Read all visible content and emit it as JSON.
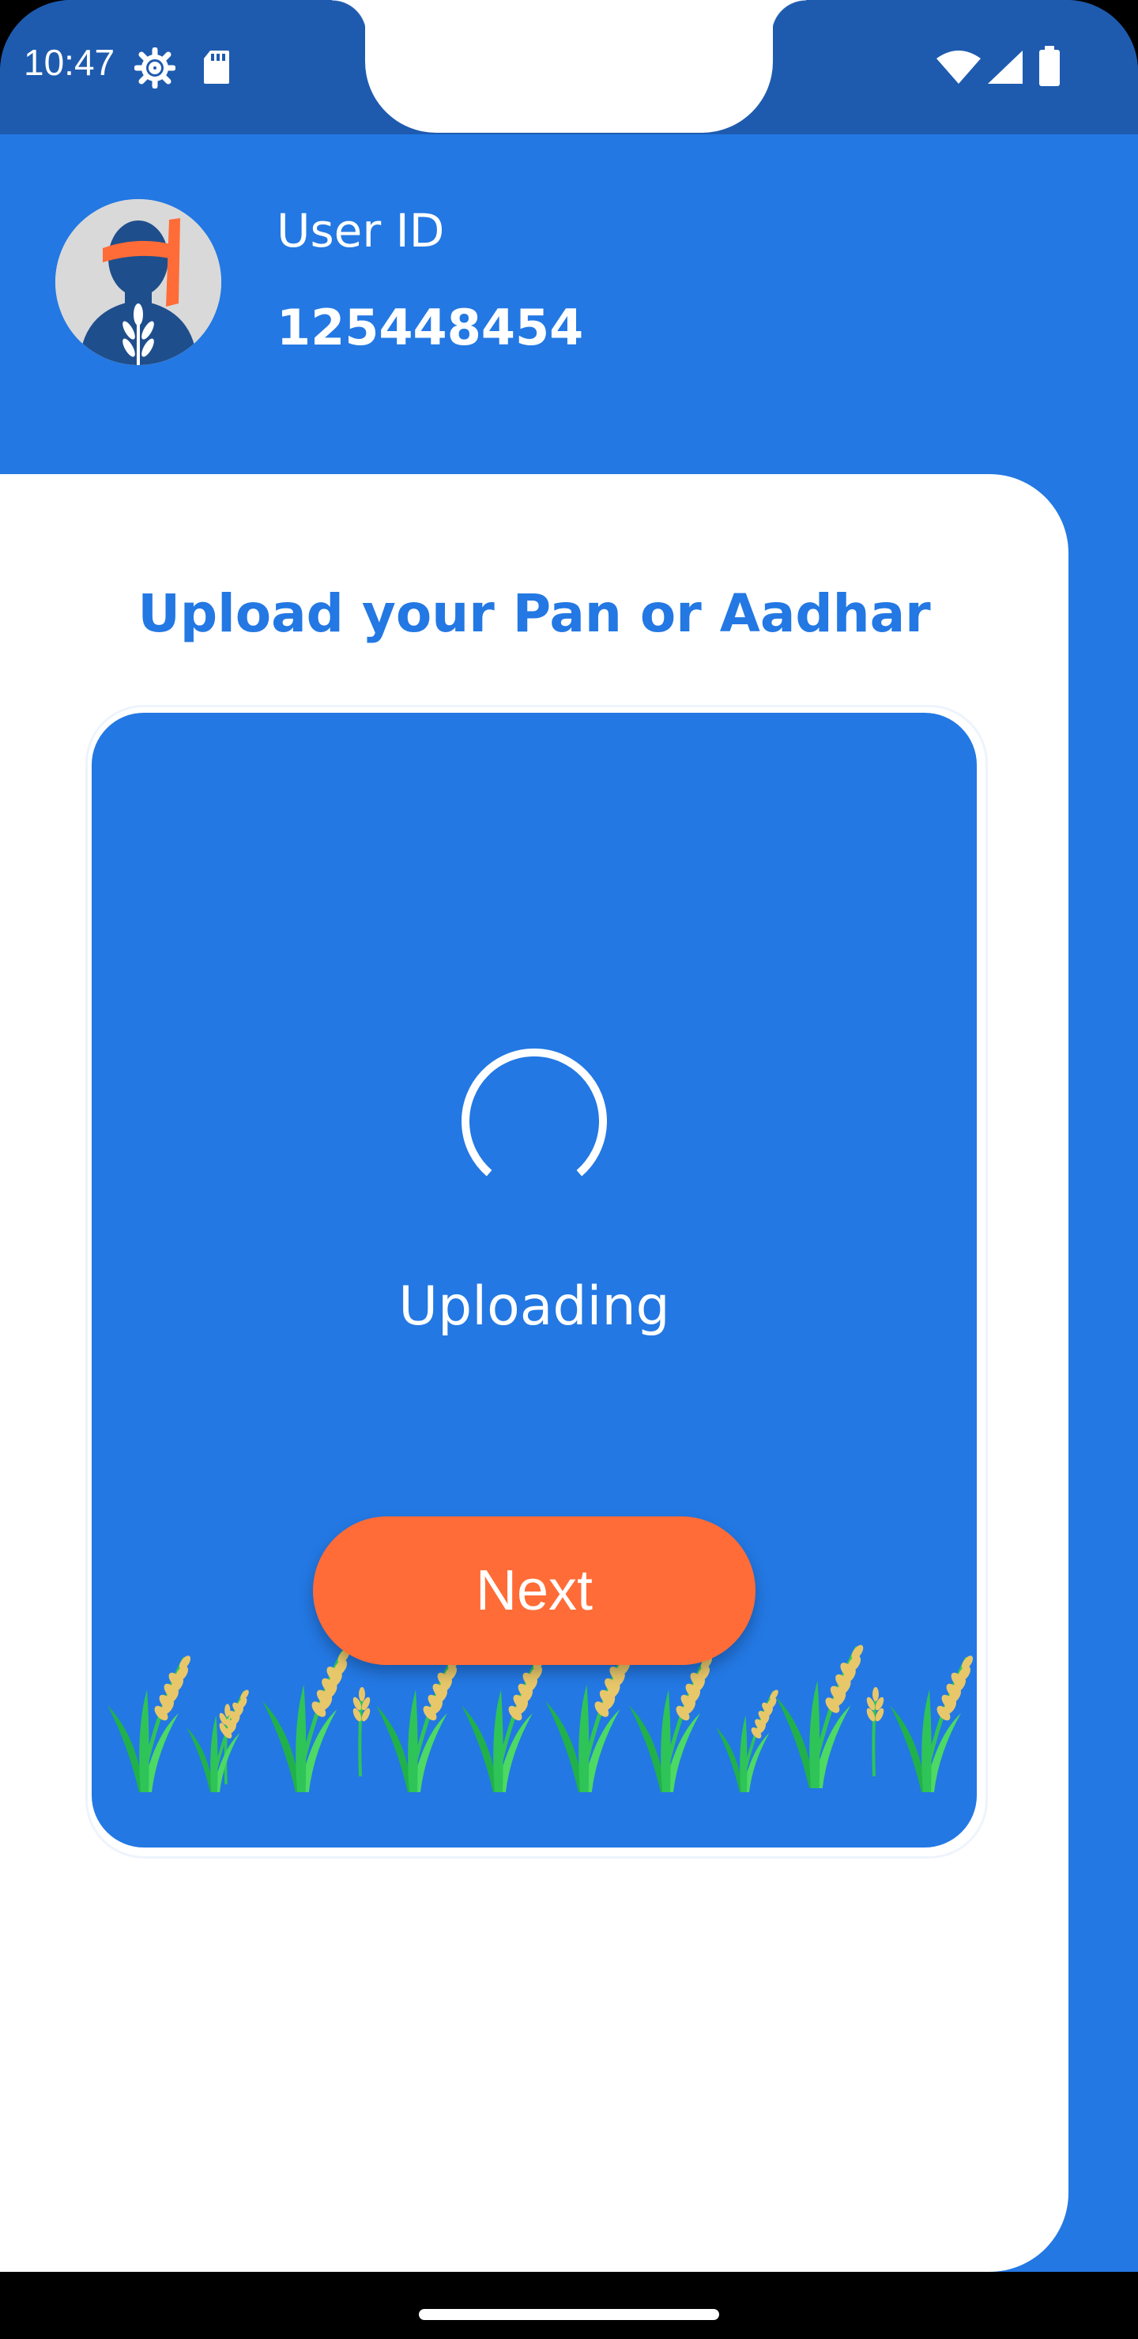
{
  "status_bar": {
    "time": "10:47",
    "icons": [
      "settings-gear-icon",
      "sd-card-icon",
      "wifi-icon",
      "cellular-signal-icon",
      "battery-icon"
    ]
  },
  "header": {
    "avatar": "farmer-avatar-icon",
    "user_label": "User ID",
    "user_id": "125448454"
  },
  "card": {
    "title": "Upload your Pan or Aadhar",
    "upload_status": "Uploading",
    "illustration": "wheat-crops-illustration"
  },
  "actions": {
    "next_label": "Next"
  },
  "colors": {
    "primary_blue": "#2378E3",
    "status_blue": "#1E5BAF",
    "accent_orange": "#FF6C37",
    "white": "#FFFFFF"
  }
}
